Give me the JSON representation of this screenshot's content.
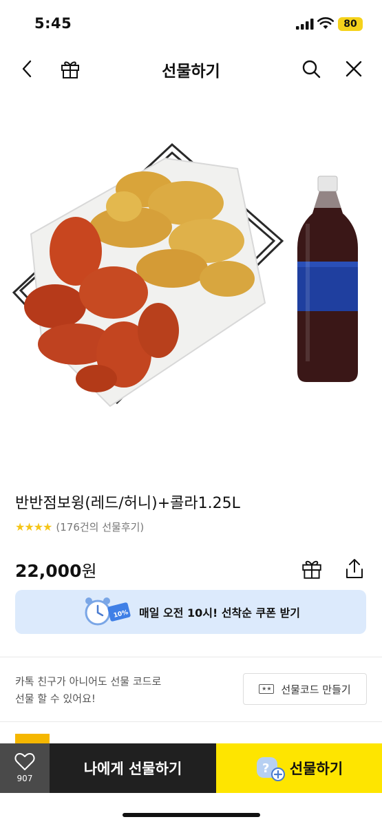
{
  "status_bar": {
    "time": "5:45",
    "battery": "80",
    "icons": [
      "signal-icon",
      "wifi-icon",
      "battery-icon"
    ]
  },
  "nav": {
    "title": "선물하기",
    "icons": [
      "back-chevron-icon",
      "gift-icon",
      "search-icon",
      "close-icon"
    ]
  },
  "product": {
    "name": "반반점보윙(레드/허니)+콜라1.25L",
    "stars": "★★★★",
    "review_count": "(176건의 선물후기)",
    "price": "22,000",
    "currency": "원",
    "actions": [
      "gift-icon",
      "share-icon"
    ]
  },
  "coupon": {
    "text": "매일 오전 10시! 선착순 쿠폰 받기",
    "badge_text": "10%"
  },
  "gift_code": {
    "description_line1": "카톡 친구가 아니어도 선물 코드로",
    "description_line2": "선물 할 수 있어요!",
    "button_label": "선물코드 만들기",
    "ticket_icon_text": "★★"
  },
  "bottom_bar": {
    "like_count": "907",
    "gift_self_label": "나에게 선물하기",
    "gift_label": "선물하기"
  },
  "colors": {
    "kakao_yellow": "#fee500",
    "dark_button": "#202020",
    "coupon_bg": "#dceafc",
    "star": "#f5c518"
  }
}
